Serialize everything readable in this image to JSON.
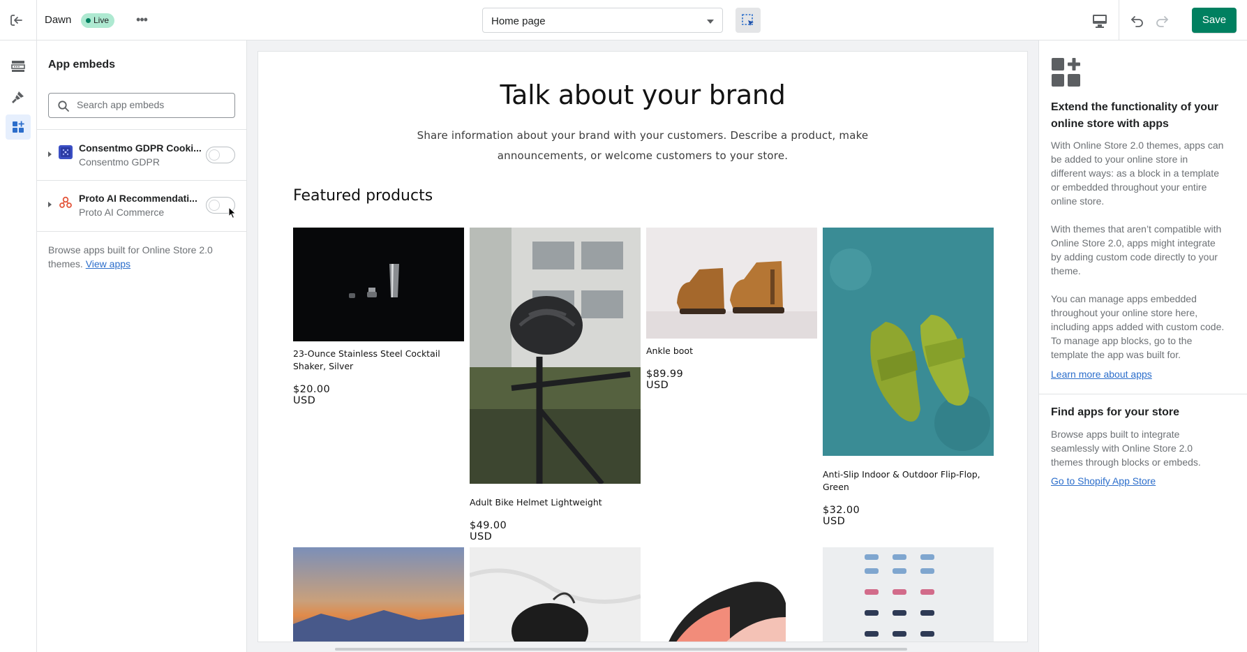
{
  "topbar": {
    "theme_name": "Dawn",
    "status_badge": "Live",
    "more_label": "•••",
    "page_select": "Home page",
    "save_label": "Save"
  },
  "rail": {
    "items": [
      {
        "icon": "sections-icon",
        "active": false
      },
      {
        "icon": "theme-settings-icon",
        "active": false
      },
      {
        "icon": "app-embeds-icon",
        "active": true
      }
    ]
  },
  "sidebar": {
    "title": "App embeds",
    "search_placeholder": "Search app embeds",
    "embeds": [
      {
        "name": "Consentmo GDPR Cooki...",
        "vendor": "Consentmo GDPR",
        "enabled": false,
        "icon_color": "#3b4fc4"
      },
      {
        "name": "Proto AI Recommendati...",
        "vendor": "Proto AI Commerce",
        "enabled": false,
        "icon_color": "#e4573d"
      }
    ],
    "footer_text": "Browse apps built for Online Store 2.0 themes.",
    "footer_link": "View apps"
  },
  "preview": {
    "hero_title": "Talk about your brand",
    "hero_text": "Share information about your brand with your customers. Describe a product, make announcements, or welcome customers to your store.",
    "featured_heading": "Featured products",
    "products": [
      {
        "title": "23-Ounce Stainless Steel Cocktail Shaker, Silver",
        "price": "$20.00 USD"
      },
      {
        "title": "Adult Bike Helmet Lightweight",
        "price": "$49.00 USD"
      },
      {
        "title": "Ankle boot",
        "price": "$89.99 USD"
      },
      {
        "title": "Anti-Slip Indoor & Outdoor Flip-Flop, Green",
        "price": "$32.00 USD"
      }
    ]
  },
  "right_panel": {
    "heading1": "Extend the functionality of your online store with apps",
    "para1": "With Online Store 2.0 themes, apps can be added to your online store in different ways: as a block in a template or embedded throughout your entire online store.",
    "para2": "With themes that aren’t compatible with Online Store 2.0, apps might integrate by adding custom code directly to your theme.",
    "para3": "You can manage apps embedded throughout your online store here, including apps added with custom code. To manage app blocks, go to the template the app was built for.",
    "link1": "Learn more about apps",
    "heading2": "Find apps for your store",
    "para4": "Browse apps built to integrate seamlessly with Online Store 2.0 themes through blocks or embeds.",
    "link2": "Go to Shopify App Store"
  },
  "colors": {
    "accent": "#008060",
    "link": "#2c6ecb",
    "badge": "#aee9d1"
  }
}
